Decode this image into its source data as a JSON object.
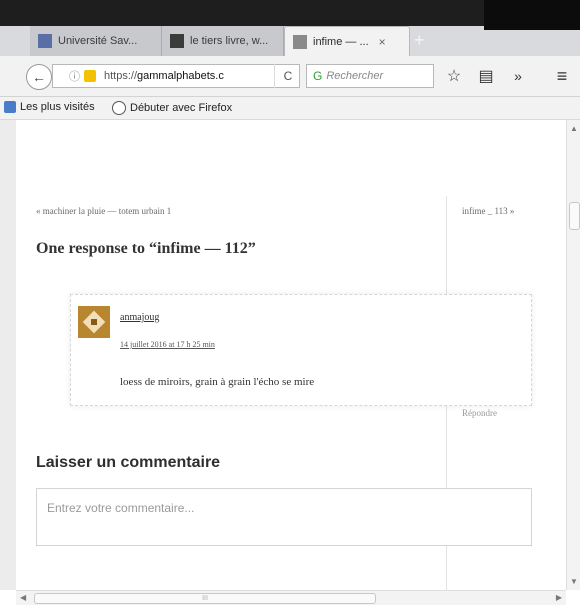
{
  "tabs": [
    {
      "title": "Université Sav...",
      "active": false,
      "close": ""
    },
    {
      "title": "le tiers livre, w...",
      "active": false,
      "close": ""
    },
    {
      "title": "infime — ...",
      "active": true,
      "close": "×"
    }
  ],
  "new_tab_symbol": "+",
  "navbar": {
    "back_symbol": "←",
    "info_symbol": "ⓘ",
    "url_prefix": "https://",
    "url_host": "gammalphabets.c",
    "reload_symbol": "C",
    "search_placeholder": "Rechercher",
    "icons": [
      "star-icon",
      "library-icon",
      "overflow-icon",
      "menu-icon"
    ]
  },
  "bookmarks": [
    {
      "label": "Les plus visités",
      "icon": "bookmarks-folder-icon"
    },
    {
      "label": "Débuter avec Firefox",
      "icon": "firefox-globe-icon"
    }
  ],
  "page": {
    "prev_link": "« machiner la pluie — totem urbain 1",
    "next_link": "infime _ 113 »",
    "responses_heading": "One response to “infime — 112”",
    "comment": {
      "author": "anmajoug",
      "date": "14 juillet 2016 at 17 h 25 min",
      "text": "loess de miroirs, grain à grain l'écho se mire",
      "reply": "Répondre"
    },
    "leave_comment_heading": "Laisser un commentaire",
    "comment_placeholder": "Entrez votre commentaire..."
  },
  "scrollbar_h_grip": "III",
  "colors": {
    "accent_tab": "#f2f2f2",
    "urlbar_lock": "#f2c200",
    "search_engine": "#2d9f2d"
  }
}
